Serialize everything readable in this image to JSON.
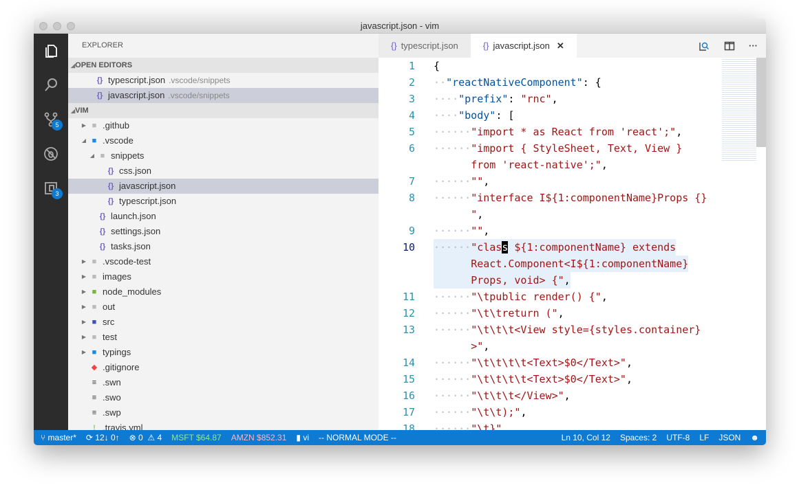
{
  "window": {
    "title": "javascript.json - vim"
  },
  "activity": [
    {
      "icon": "files-icon"
    },
    {
      "icon": "search-icon"
    },
    {
      "icon": "source-control-icon",
      "badge": "5"
    },
    {
      "icon": "debug-icon"
    },
    {
      "icon": "extensions-icon",
      "badge": "3"
    }
  ],
  "sidebar": {
    "title": "EXPLORER",
    "open_editors_label": "OPEN EDITORS",
    "open_editors": [
      {
        "name": "typescript.json",
        "desc": ".vscode/snippets"
      },
      {
        "name": "javascript.json",
        "desc": ".vscode/snippets"
      }
    ],
    "folder_label": "VIM",
    "tree": [
      {
        "name": ".github",
        "type": "folder",
        "depth": 1,
        "twisty": "▶",
        "color": "#bbb"
      },
      {
        "name": ".vscode",
        "type": "folder",
        "depth": 1,
        "twisty": "◢",
        "color": "#1e88e5"
      },
      {
        "name": "snippets",
        "type": "folder",
        "depth": 2,
        "twisty": "◢",
        "color": "#bbb"
      },
      {
        "name": "css.json",
        "type": "json",
        "depth": 3
      },
      {
        "name": "javascript.json",
        "type": "json",
        "depth": 3,
        "selected": true
      },
      {
        "name": "typescript.json",
        "type": "json",
        "depth": 3
      },
      {
        "name": "launch.json",
        "type": "json",
        "depth": 2
      },
      {
        "name": "settings.json",
        "type": "json",
        "depth": 2
      },
      {
        "name": "tasks.json",
        "type": "json",
        "depth": 2
      },
      {
        "name": ".vscode-test",
        "type": "folder",
        "depth": 1,
        "twisty": "▶",
        "color": "#bbb"
      },
      {
        "name": "images",
        "type": "folder",
        "depth": 1,
        "twisty": "▶",
        "color": "#bbb"
      },
      {
        "name": "node_modules",
        "type": "folder",
        "depth": 1,
        "twisty": "▶",
        "color": "#7cb342"
      },
      {
        "name": "out",
        "type": "folder",
        "depth": 1,
        "twisty": "▶",
        "color": "#bbb"
      },
      {
        "name": "src",
        "type": "folder",
        "depth": 1,
        "twisty": "▶",
        "color": "#3f51b5"
      },
      {
        "name": "test",
        "type": "folder",
        "depth": 1,
        "twisty": "▶",
        "color": "#bbb"
      },
      {
        "name": "typings",
        "type": "folder",
        "depth": 1,
        "twisty": "▶",
        "color": "#1e88e5"
      },
      {
        "name": ".gitignore",
        "type": "git",
        "depth": 1
      },
      {
        "name": ".swn",
        "type": "file",
        "depth": 1
      },
      {
        "name": ".swo",
        "type": "file",
        "depth": 1
      },
      {
        "name": ".swp",
        "type": "file",
        "depth": 1
      },
      {
        "name": ".travis.yml",
        "type": "yml",
        "depth": 1
      }
    ]
  },
  "editor": {
    "tabs": [
      {
        "label": "typescript.json",
        "active": false
      },
      {
        "label": "javascript.json",
        "active": true
      }
    ],
    "actions": [
      {
        "icon": "open-preview-icon"
      },
      {
        "icon": "split-editor-icon"
      },
      {
        "icon": "more-icon"
      }
    ],
    "lines": [
      {
        "n": "1",
        "seg": [
          [
            "p",
            "{"
          ]
        ]
      },
      {
        "n": "2",
        "seg": [
          [
            "d",
            "··"
          ],
          [
            "k",
            "\"reactNativeComponent\""
          ],
          [
            "p",
            ": {"
          ]
        ]
      },
      {
        "n": "3",
        "seg": [
          [
            "d",
            "····"
          ],
          [
            "k",
            "\"prefix\""
          ],
          [
            "p",
            ": "
          ],
          [
            "s",
            "\"rnc\""
          ],
          [
            "p",
            ","
          ]
        ]
      },
      {
        "n": "4",
        "seg": [
          [
            "d",
            "····"
          ],
          [
            "k",
            "\"body\""
          ],
          [
            "p",
            ": ["
          ]
        ]
      },
      {
        "n": "5",
        "seg": [
          [
            "d",
            "······"
          ],
          [
            "s",
            "\"import * as React from 'react';\""
          ],
          [
            "p",
            ","
          ]
        ]
      },
      {
        "n": "6",
        "seg": [
          [
            "d",
            "······"
          ],
          [
            "s",
            "\"import { StyleSheet, Text, View }"
          ]
        ]
      },
      {
        "n": "",
        "seg": [
          [
            "d",
            "      "
          ],
          [
            "s",
            "from 'react-native';\""
          ],
          [
            "p",
            ","
          ]
        ]
      },
      {
        "n": "7",
        "seg": [
          [
            "d",
            "······"
          ],
          [
            "s",
            "\"\""
          ],
          [
            "p",
            ","
          ]
        ]
      },
      {
        "n": "8",
        "seg": [
          [
            "d",
            "······"
          ],
          [
            "s",
            "\"interface I${1:componentName}Props {}"
          ]
        ]
      },
      {
        "n": "",
        "seg": [
          [
            "d",
            "      "
          ],
          [
            "s",
            "\""
          ],
          [
            "p",
            ","
          ]
        ]
      },
      {
        "n": "9",
        "seg": [
          [
            "d",
            "······"
          ],
          [
            "s",
            "\"\""
          ],
          [
            "p",
            ","
          ]
        ]
      },
      {
        "n": "10",
        "cur": true,
        "seg": [
          [
            "d",
            "······"
          ],
          [
            "s",
            "\"clas"
          ],
          [
            "c",
            "s"
          ],
          [
            "s",
            " ${1:componentName} extends"
          ]
        ]
      },
      {
        "n": "",
        "cur": true,
        "seg": [
          [
            "d",
            "      "
          ],
          [
            "s",
            "React.Component<I${1:componentName}"
          ]
        ]
      },
      {
        "n": "",
        "cur": true,
        "seg": [
          [
            "d",
            "      "
          ],
          [
            "s",
            "Props, void> {\""
          ],
          [
            "p",
            ","
          ]
        ]
      },
      {
        "n": "11",
        "seg": [
          [
            "d",
            "······"
          ],
          [
            "s",
            "\"\\tpublic render() {\""
          ],
          [
            "p",
            ","
          ]
        ]
      },
      {
        "n": "12",
        "seg": [
          [
            "d",
            "······"
          ],
          [
            "s",
            "\"\\t\\treturn (\""
          ],
          [
            "p",
            ","
          ]
        ]
      },
      {
        "n": "13",
        "seg": [
          [
            "d",
            "······"
          ],
          [
            "s",
            "\"\\t\\t\\t<View style={styles.container}"
          ]
        ]
      },
      {
        "n": "",
        "seg": [
          [
            "d",
            "      "
          ],
          [
            "s",
            "&gt;\""
          ],
          [
            "p",
            ","
          ]
        ]
      },
      {
        "n": "14",
        "seg": [
          [
            "d",
            "······"
          ],
          [
            "s",
            "\"\\t\\t\\t\\t<Text>$0</Text>\""
          ],
          [
            "p",
            ","
          ]
        ]
      },
      {
        "n": "15",
        "seg": [
          [
            "d",
            "······"
          ],
          [
            "s",
            "\"\\t\\t\\t\\t<Text>$0</Text>\""
          ],
          [
            "p",
            ","
          ]
        ]
      },
      {
        "n": "16",
        "seg": [
          [
            "d",
            "······"
          ],
          [
            "s",
            "\"\\t\\t\\t</View>\""
          ],
          [
            "p",
            ","
          ]
        ]
      },
      {
        "n": "17",
        "seg": [
          [
            "d",
            "······"
          ],
          [
            "s",
            "\"\\t\\t);\""
          ],
          [
            "p",
            ","
          ]
        ]
      },
      {
        "n": "18",
        "seg": [
          [
            "d",
            "······"
          ],
          [
            "s",
            "\"\\t}\""
          ],
          [
            "p",
            ","
          ]
        ]
      }
    ]
  },
  "status": {
    "branch": "master*",
    "sync": "12↓ 0↑",
    "errors": "0",
    "warnings": "4",
    "msft": "MSFT $64.87",
    "amzn": "AMZN $852.31",
    "folder": "vi",
    "mode": "-- NORMAL MODE --",
    "position": "Ln 10, Col 12",
    "spaces": "Spaces: 2",
    "encoding": "UTF-8",
    "eol": "LF",
    "language": "JSON",
    "colors": {
      "bar": "#0e7ad1",
      "msft": "#8fe88f",
      "amzn": "#f7b7c7"
    }
  }
}
